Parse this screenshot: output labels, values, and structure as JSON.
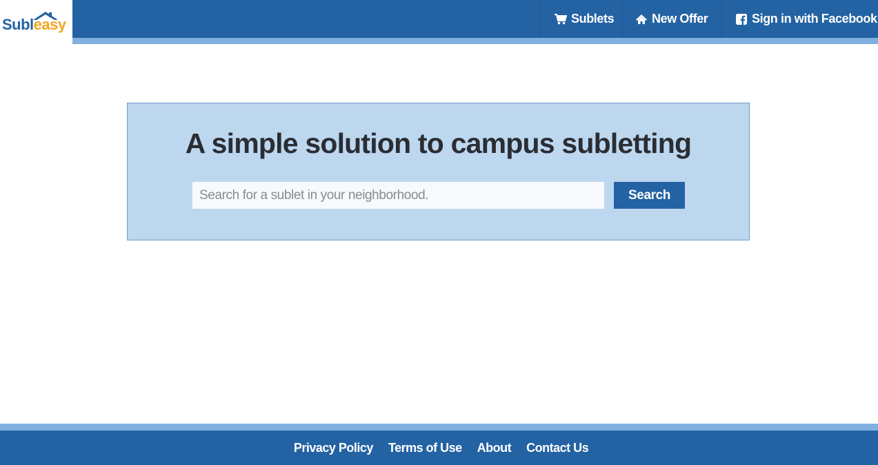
{
  "brand": {
    "logo_part1": "Subl",
    "logo_part2": "easy",
    "colors": {
      "primary": "#2463a3",
      "accent": "#f5a623",
      "stripe": "#7fb0e0",
      "hero_bg": "#bdd7ef"
    }
  },
  "nav": {
    "items": [
      {
        "label": "Sublets",
        "icon": "cart-icon"
      },
      {
        "label": "New Offer",
        "icon": "home-icon"
      },
      {
        "label": "Sign in with Facebook",
        "icon": "facebook-icon"
      }
    ]
  },
  "hero": {
    "title": "A simple solution to campus subletting",
    "search_placeholder": "Search for a sublet in your neighborhood.",
    "search_value": "",
    "search_button": "Search"
  },
  "footer": {
    "links": [
      "Privacy Policy",
      "Terms of Use",
      "About",
      "Contact Us"
    ]
  }
}
